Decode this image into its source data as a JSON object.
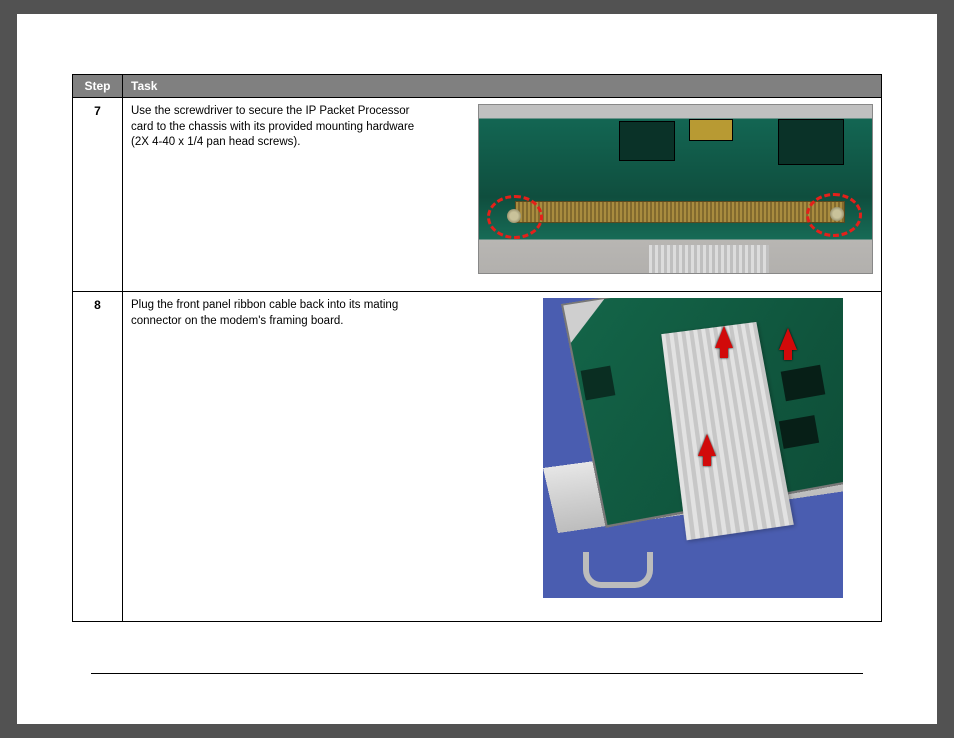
{
  "table": {
    "headers": {
      "step": "Step",
      "task": "Task"
    },
    "rows": [
      {
        "step": "7",
        "task": "Use the screwdriver to secure the IP Packet Processor card to the chassis with its provided mounting hardware (2X 4-40 x 1/4 pan head screws).",
        "image_alt": "circuit-board-screw-locations"
      },
      {
        "step": "8",
        "task": "Plug the front panel ribbon cable back into its mating connector on the modem's framing board.",
        "image_alt": "ribbon-cable-reconnect"
      }
    ]
  }
}
